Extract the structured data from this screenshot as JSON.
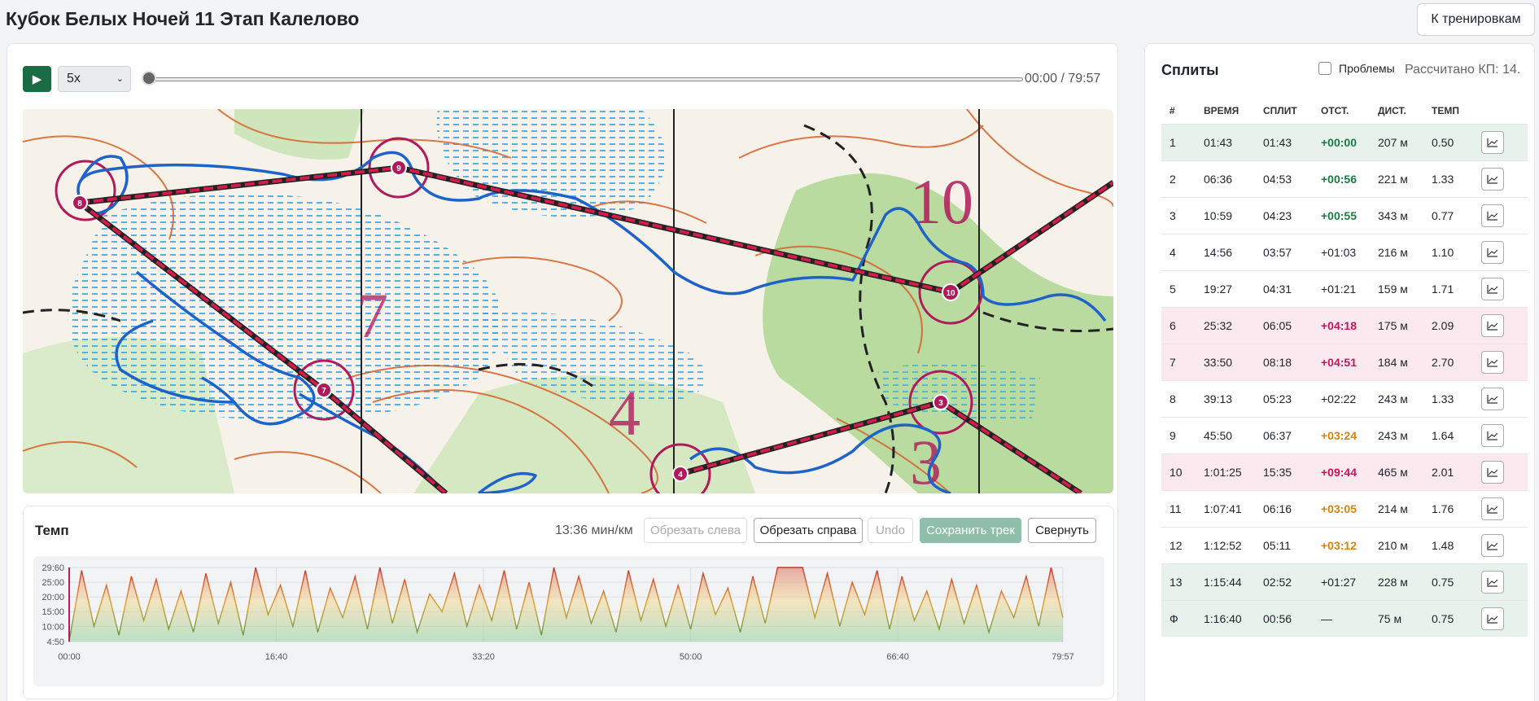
{
  "page": {
    "title": "Кубок Белых Ночей 11 Этап Калелово",
    "back_label": "К тренировкам"
  },
  "player": {
    "play_icon": "▶",
    "speed": "5x",
    "time": "00:00 / 79:57",
    "progress": 0
  },
  "map": {
    "controls": [
      "3",
      "4",
      "7",
      "8",
      "9",
      "10"
    ],
    "map_numbers": [
      "10",
      "7",
      "4",
      "3"
    ],
    "colors": {
      "route_line": "#d11d4b",
      "track": "#1f63c8",
      "control": "#b01a5a"
    }
  },
  "pace": {
    "title": "Темп",
    "value": "13:36 мин/км",
    "buttons": {
      "trim_left": "Обрезать слева",
      "trim_right": "Обрезать справа",
      "undo": "Undo",
      "save": "Сохранить трек",
      "collapse": "Свернуть"
    }
  },
  "chart_data": {
    "type": "area",
    "y_tick_labels": [
      "29:60",
      "25:00",
      "20:00",
      "15:00",
      "10:00",
      "4:50"
    ],
    "x_tick_labels": [
      "00:00",
      "16:40",
      "33:20",
      "50:00",
      "66:40",
      "79:57"
    ],
    "ylim": [
      4.833,
      30
    ],
    "xlim": [
      0,
      79.95
    ],
    "grid": true,
    "values_note_free": true,
    "x": [
      0,
      1,
      2,
      3,
      4,
      5,
      6,
      7,
      8,
      9,
      10,
      11,
      12,
      13,
      14,
      15,
      16,
      17,
      18,
      19,
      20,
      21,
      22,
      23,
      24,
      25,
      26,
      27,
      28,
      29,
      30,
      31,
      32,
      33,
      34,
      35,
      36,
      37,
      38,
      39,
      40,
      41,
      42,
      43,
      44,
      45,
      46,
      47,
      48,
      49,
      50,
      51,
      52,
      53,
      54,
      55,
      56,
      57,
      58,
      59,
      60,
      61,
      62,
      63,
      64,
      65,
      66,
      67,
      68,
      69,
      70,
      71,
      72,
      73,
      74,
      75,
      76,
      77,
      78,
      79,
      79.95
    ],
    "y": [
      5,
      29,
      10,
      24,
      7,
      27,
      12,
      26,
      9,
      22,
      8,
      28,
      11,
      25,
      7,
      30,
      14,
      24,
      10,
      29,
      8,
      23,
      13,
      27,
      9,
      30,
      11,
      26,
      8,
      21,
      15,
      28,
      10,
      24,
      12,
      29,
      9,
      25,
      7,
      30,
      13,
      27,
      11,
      22,
      8,
      29,
      12,
      26,
      10,
      24,
      9,
      28,
      14,
      23,
      8,
      27,
      11,
      30,
      30,
      30,
      13,
      28,
      10,
      25,
      14,
      29,
      9,
      27,
      12,
      22,
      9,
      26,
      11,
      24,
      8,
      22,
      13,
      27,
      10,
      30,
      13
    ]
  },
  "splits": {
    "title": "Сплиты",
    "problems_label": "Проблемы",
    "calc_label": "Рассчитано КП: 14.",
    "headers": [
      "#",
      "ВРЕМЯ",
      "СПЛИТ",
      "ОТСТ.",
      "ДИСТ.",
      "ТЕМП"
    ],
    "rows": [
      {
        "n": "1",
        "time": "01:43",
        "split": "01:43",
        "lag": "+00:00",
        "dist": "207 м",
        "pace": "0.50",
        "row": "good",
        "lag_color": "green"
      },
      {
        "n": "2",
        "time": "06:36",
        "split": "04:53",
        "lag": "+00:56",
        "dist": "221 м",
        "pace": "1.33",
        "row": "",
        "lag_color": "green"
      },
      {
        "n": "3",
        "time": "10:59",
        "split": "04:23",
        "lag": "+00:55",
        "dist": "343 м",
        "pace": "0.77",
        "row": "",
        "lag_color": "green"
      },
      {
        "n": "4",
        "time": "14:56",
        "split": "03:57",
        "lag": "+01:03",
        "dist": "216 м",
        "pace": "1.10",
        "row": "",
        "lag_color": ""
      },
      {
        "n": "5",
        "time": "19:27",
        "split": "04:31",
        "lag": "+01:21",
        "dist": "159 м",
        "pace": "1.71",
        "row": "",
        "lag_color": ""
      },
      {
        "n": "6",
        "time": "25:32",
        "split": "06:05",
        "lag": "+04:18",
        "dist": "175 м",
        "pace": "2.09",
        "row": "bad",
        "lag_color": "red"
      },
      {
        "n": "7",
        "time": "33:50",
        "split": "08:18",
        "lag": "+04:51",
        "dist": "184 м",
        "pace": "2.70",
        "row": "bad",
        "lag_color": "red"
      },
      {
        "n": "8",
        "time": "39:13",
        "split": "05:23",
        "lag": "+02:22",
        "dist": "243 м",
        "pace": "1.33",
        "row": "",
        "lag_color": ""
      },
      {
        "n": "9",
        "time": "45:50",
        "split": "06:37",
        "lag": "+03:24",
        "dist": "243 м",
        "pace": "1.64",
        "row": "",
        "lag_color": "orange"
      },
      {
        "n": "10",
        "time": "1:01:25",
        "split": "15:35",
        "lag": "+09:44",
        "dist": "465 м",
        "pace": "2.01",
        "row": "bad",
        "lag_color": "red"
      },
      {
        "n": "11",
        "time": "1:07:41",
        "split": "06:16",
        "lag": "+03:05",
        "dist": "214 м",
        "pace": "1.76",
        "row": "",
        "lag_color": "orange"
      },
      {
        "n": "12",
        "time": "1:12:52",
        "split": "05:11",
        "lag": "+03:12",
        "dist": "210 м",
        "pace": "1.48",
        "row": "",
        "lag_color": "orange"
      },
      {
        "n": "13",
        "time": "1:15:44",
        "split": "02:52",
        "lag": "+01:27",
        "dist": "228 м",
        "pace": "0.75",
        "row": "good",
        "lag_color": ""
      },
      {
        "n": "Ф",
        "time": "1:16:40",
        "split": "00:56",
        "lag": "—",
        "dist": "75 м",
        "pace": "0.75",
        "row": "good",
        "lag_color": ""
      }
    ]
  }
}
